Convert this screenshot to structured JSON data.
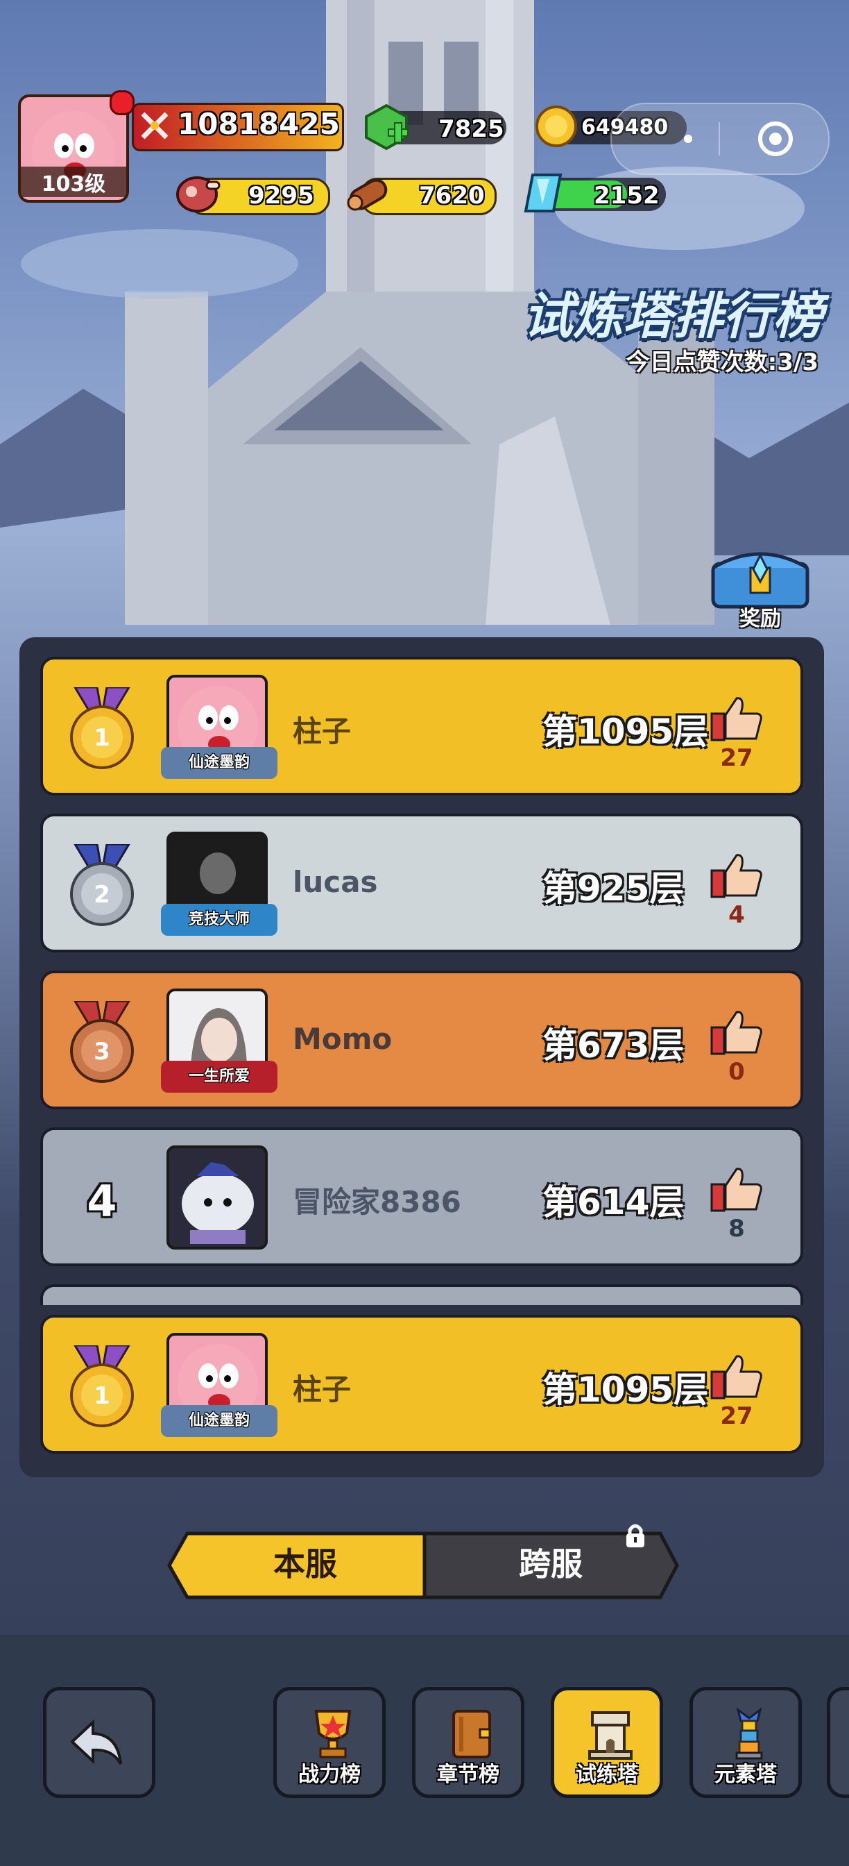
{
  "hud": {
    "level": "103级",
    "combat_power": "10818425",
    "gems": "7825",
    "gold": "649480",
    "meat": "9295",
    "wood": "7620",
    "crystal": "2152"
  },
  "title": "试炼塔排行榜",
  "daily_likes": "今日点赞次数:3/3",
  "reward_label": "奖励",
  "leaderboard": [
    {
      "rank": "1",
      "name": "柱子",
      "badge": "仙途墨韵",
      "floor": "第1095层",
      "likes": "27"
    },
    {
      "rank": "2",
      "name": "lucas",
      "badge": "竞技大师",
      "floor": "第925层",
      "likes": "4"
    },
    {
      "rank": "3",
      "name": "Momo",
      "badge": "一生所爱",
      "floor": "第673层",
      "likes": "0"
    },
    {
      "rank": "4",
      "name": "冒险家8386",
      "badge": "",
      "floor": "第614层",
      "likes": "8"
    }
  ],
  "my_entry": {
    "rank": "1",
    "name": "柱子",
    "badge": "仙途墨韵",
    "floor": "第1095层",
    "likes": "27"
  },
  "tabs": {
    "local": "本服",
    "cross": "跨服"
  },
  "nav": {
    "back": "",
    "power": "战力榜",
    "chapter": "章节榜",
    "trial": "试练塔",
    "element": "元素塔"
  },
  "colors": {
    "gold_row": "#f2c026",
    "silver_row": "#cfd6da",
    "bronze_row": "#e58a45",
    "plain_row": "#a3aab8"
  }
}
